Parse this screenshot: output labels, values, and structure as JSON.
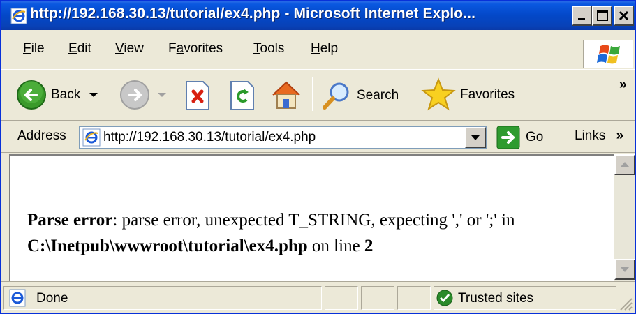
{
  "window": {
    "title": "http://192.168.30.13/tutorial/ex4.php - Microsoft Internet Explo..."
  },
  "menu": {
    "items": [
      {
        "label": "File",
        "key": "F"
      },
      {
        "label": "Edit",
        "key": "E"
      },
      {
        "label": "View",
        "key": "V"
      },
      {
        "label": "Favorites",
        "key": "a"
      },
      {
        "label": "Tools",
        "key": "T"
      },
      {
        "label": "Help",
        "key": "H"
      }
    ]
  },
  "toolbar": {
    "back_label": "Back",
    "search_label": "Search",
    "favorites_label": "Favorites",
    "overflow": "»"
  },
  "address": {
    "label": "Address",
    "url": "http://192.168.30.13/tutorial/ex4.php",
    "go_label": "Go",
    "links_label": "Links",
    "links_overflow": "»"
  },
  "page": {
    "error_label": "Parse error",
    "error_message": ": parse error, unexpected T_STRING, expecting ',' or ';' in ",
    "file_path": "C:\\Inetpub\\wwwroot\\tutorial\\ex4.php",
    "line_text": " on line ",
    "line_number": "2"
  },
  "status": {
    "text": "Done",
    "zone": "Trusted sites"
  },
  "colors": {
    "titlebar": "#0348c8",
    "chrome": "#ece9d8",
    "go_green": "#2f9b2f",
    "back_green": "#3a9a2a"
  }
}
